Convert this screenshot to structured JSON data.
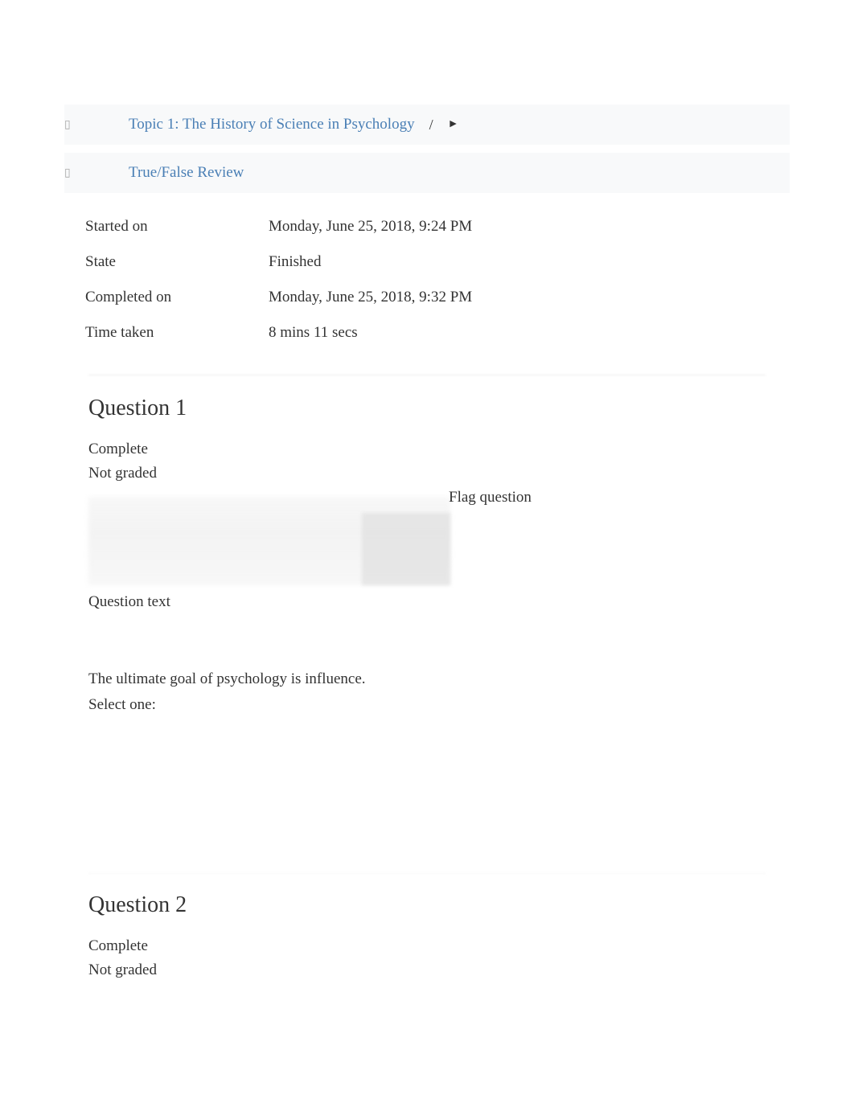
{
  "breadcrumbs": {
    "topic": "Topic 1: The History of Science in Psychology",
    "separator": "/",
    "arrow": "►",
    "review": "True/False Review"
  },
  "meta": {
    "started_label": "Started on",
    "started_value": "Monday, June 25, 2018, 9:24 PM",
    "state_label": "State",
    "state_value": "Finished",
    "completed_label": "Completed on",
    "completed_value": "Monday, June 25, 2018, 9:32 PM",
    "time_label": "Time taken",
    "time_value": "8 mins 11 secs"
  },
  "question1": {
    "title": "Question 1",
    "status": "Complete",
    "grade": "Not graded",
    "flag": "Flag question",
    "text_label": "Question text",
    "body": "The ultimate goal of psychology is influence.",
    "select": "Select one:"
  },
  "question2": {
    "title": "Question 2",
    "status": "Complete",
    "grade": "Not graded"
  }
}
